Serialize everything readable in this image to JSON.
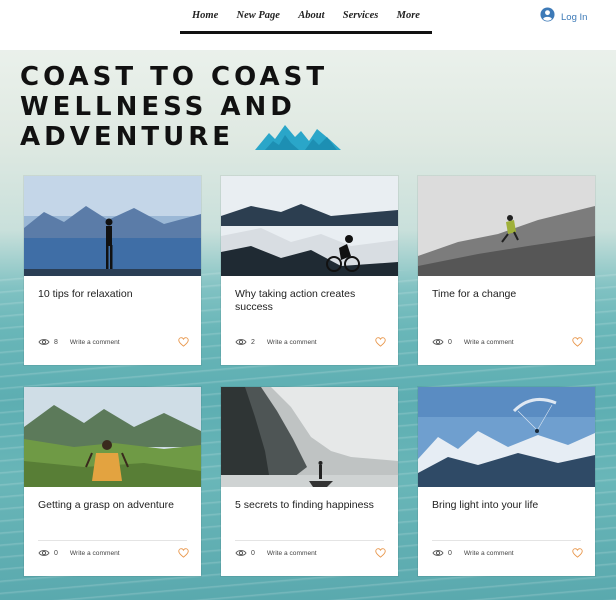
{
  "nav": {
    "items": [
      "Home",
      "New Page",
      "About",
      "Services",
      "More"
    ],
    "login_label": "Log In"
  },
  "headline": {
    "lines": [
      "COAST TO COAST",
      "WELLNESS AND",
      "ADVENTURE"
    ]
  },
  "posts": [
    {
      "title": "10 tips for relaxation",
      "views": "8",
      "comment_label": "Write a comment"
    },
    {
      "title": "Why taking action creates success",
      "views": "2",
      "comment_label": "Write a comment"
    },
    {
      "title": "Time for a change",
      "views": "0",
      "comment_label": "Write a comment"
    },
    {
      "title": "Getting a grasp on adventure",
      "views": "0",
      "comment_label": "Write a comment"
    },
    {
      "title": "5 secrets to finding happiness",
      "views": "0",
      "comment_label": "Write a comment"
    },
    {
      "title": "Bring light into your life",
      "views": "0",
      "comment_label": "Write a comment"
    }
  ],
  "icons": {
    "views": "eye-icon",
    "like": "heart-icon",
    "user": "user-avatar-icon",
    "logo": "mountains-logo-icon"
  },
  "colors": {
    "accent_blue": "#3d7ab7",
    "heart_orange": "#e8964a",
    "logo_teal": "#2aa6c9"
  }
}
